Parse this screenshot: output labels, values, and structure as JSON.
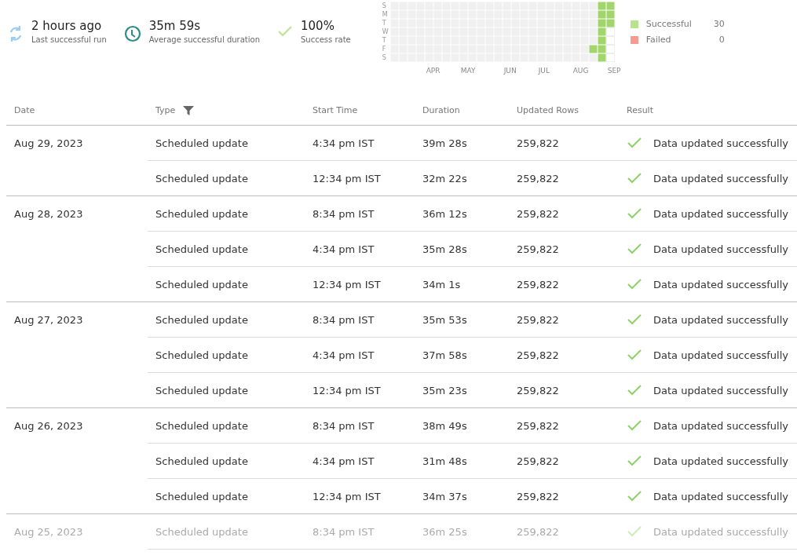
{
  "stats": [
    {
      "kind": "sync",
      "value": "2 hours ago",
      "label": "Last successful run"
    },
    {
      "kind": "clock",
      "value": "35m 59s",
      "label": "Average successful duration"
    },
    {
      "kind": "check",
      "value": "100%",
      "label": "Success rate"
    }
  ],
  "heatmap": {
    "day_labels": [
      "S",
      "M",
      "T",
      "W",
      "T",
      "F",
      "S"
    ],
    "months": [
      "APR",
      "MAY",
      "JUN",
      "JUL",
      "AUG",
      "SEP"
    ],
    "legend": [
      {
        "label": "Successful",
        "count": "30",
        "color": "#b9e28f"
      },
      {
        "label": "Failed",
        "count": "0",
        "color": "#f59b92"
      }
    ]
  },
  "table": {
    "columns": [
      {
        "label": "Date",
        "filter": false
      },
      {
        "label": "Type",
        "filter": true
      },
      {
        "label": "Start Time",
        "filter": false
      },
      {
        "label": "Duration",
        "filter": false
      },
      {
        "label": "Updated Rows",
        "filter": false
      },
      {
        "label": "Result",
        "filter": false
      }
    ],
    "groups": [
      {
        "date": "Aug 29, 2023",
        "faded": false,
        "runs": [
          {
            "type": "Scheduled update",
            "start": "4:34 pm IST",
            "duration": "39m 28s",
            "rows": "259,822",
            "kind": "success",
            "result": "Data updated successfully"
          },
          {
            "type": "Scheduled update",
            "start": "12:34 pm IST",
            "duration": "32m 22s",
            "rows": "259,822",
            "kind": "success",
            "result": "Data updated successfully"
          }
        ]
      },
      {
        "date": "Aug 28, 2023",
        "faded": false,
        "runs": [
          {
            "type": "Scheduled update",
            "start": "8:34 pm IST",
            "duration": "36m 12s",
            "rows": "259,822",
            "kind": "success",
            "result": "Data updated successfully"
          },
          {
            "type": "Scheduled update",
            "start": "4:34 pm IST",
            "duration": "35m 28s",
            "rows": "259,822",
            "kind": "success",
            "result": "Data updated successfully"
          },
          {
            "type": "Scheduled update",
            "start": "12:34 pm IST",
            "duration": "34m 1s",
            "rows": "259,822",
            "kind": "success",
            "result": "Data updated successfully"
          }
        ]
      },
      {
        "date": "Aug 27, 2023",
        "faded": false,
        "runs": [
          {
            "type": "Scheduled update",
            "start": "8:34 pm IST",
            "duration": "35m 53s",
            "rows": "259,822",
            "kind": "success",
            "result": "Data updated successfully"
          },
          {
            "type": "Scheduled update",
            "start": "4:34 pm IST",
            "duration": "37m 58s",
            "rows": "259,822",
            "kind": "success",
            "result": "Data updated successfully"
          },
          {
            "type": "Scheduled update",
            "start": "12:34 pm IST",
            "duration": "35m 23s",
            "rows": "259,822",
            "kind": "success",
            "result": "Data updated successfully"
          }
        ]
      },
      {
        "date": "Aug 26, 2023",
        "faded": false,
        "runs": [
          {
            "type": "Scheduled update",
            "start": "8:34 pm IST",
            "duration": "38m 49s",
            "rows": "259,822",
            "kind": "success",
            "result": "Data updated successfully"
          },
          {
            "type": "Scheduled update",
            "start": "4:34 pm IST",
            "duration": "31m 48s",
            "rows": "259,822",
            "kind": "success",
            "result": "Data updated successfully"
          },
          {
            "type": "Scheduled update",
            "start": "12:34 pm IST",
            "duration": "34m 37s",
            "rows": "259,822",
            "kind": "success",
            "result": "Data updated successfully"
          }
        ]
      },
      {
        "date": "Aug 25, 2023",
        "faded": true,
        "runs": [
          {
            "type": "Scheduled update",
            "start": "8:34 pm IST",
            "duration": "36m 25s",
            "rows": "259,822",
            "kind": "success",
            "result": "Data updated successfully"
          }
        ]
      }
    ]
  }
}
